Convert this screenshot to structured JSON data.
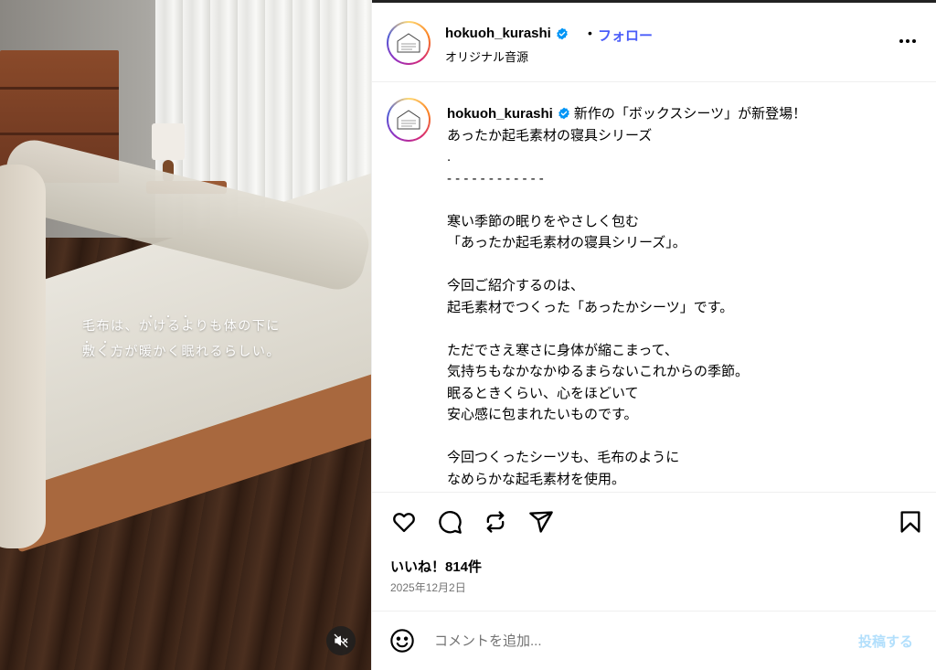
{
  "video": {
    "overlay_line1": "毛布は、かけるよりも体の下に",
    "overlay_line2": "敷く方が暖かく眠れるらしい。",
    "emphasis_dots_line1": "・・・",
    "emphasis_dots_line2": "・・",
    "mute_icon": "speaker-muted-icon"
  },
  "post": {
    "username": "hokuoh_kurashi",
    "verified_icon": "verified-badge-icon",
    "separator": "•",
    "follow_label": "フォロー",
    "audio_label": "オリジナル音源",
    "more_icon": "more-options-icon",
    "avatar_logo_text": "hokuoh kurashi"
  },
  "caption": {
    "username": "hokuoh_kurashi",
    "text": "新作の「ボックスシーツ」が新登場！\nあったか起毛素材の寝具シリーズ\n.\n- - - - - - - - - - - -\n\n寒い季節の眠りをやさしく包む\n「あったか起毛素材の寝具シリーズ」。\n\n今回ご紹介するのは、\n起毛素材でつくった「あったかシーツ」です。\n\nただでさえ寒さに身体が縮こまって、\n気持ちもなかなかゆるまらないこれからの季節。\n眠るときくらい、心をほどいて\n安心感に包まれたいものです。\n\n今回つくったシーツも、毛布のように\nなめらかな起毛素材を使用。"
  },
  "actions": {
    "like_icon": "heart-icon",
    "comment_icon": "comment-icon",
    "repost_icon": "repost-icon",
    "share_icon": "share-icon",
    "save_icon": "bookmark-icon"
  },
  "likes_text": "いいね！814件",
  "date_text": "2025年12月2日",
  "comment": {
    "emoji_icon": "emoji-icon",
    "placeholder": "コメントを追加...",
    "post_label": "投稿する"
  },
  "colors": {
    "accent_blue": "#4a5df9",
    "post_button_disabled": "#b2dffc",
    "muted_text": "#737373",
    "verified_blue": "#0095f6"
  }
}
